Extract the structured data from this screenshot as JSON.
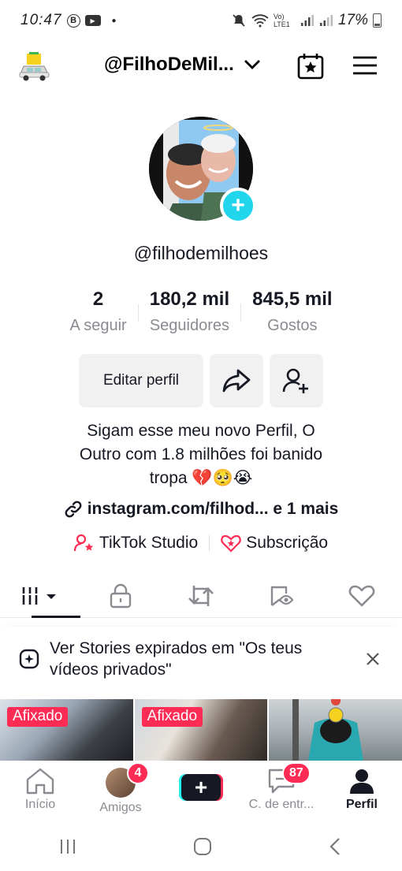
{
  "status_bar": {
    "time": "10:47",
    "b_icon": "B",
    "network": "Vo) LTE1",
    "battery_pct": "17%"
  },
  "header": {
    "handle": "@FilhoDeMil...",
    "icons": [
      "car-logo-icon",
      "chevron-down-icon",
      "calendar-star-icon",
      "menu-icon"
    ]
  },
  "profile": {
    "username": "@filhodemilhoes",
    "stats": [
      {
        "value": "2",
        "label": "A seguir"
      },
      {
        "value": "180,2 mil",
        "label": "Seguidores"
      },
      {
        "value": "845,5 mil",
        "label": "Gostos"
      }
    ],
    "edit_label": "Editar perfil",
    "bio_line1": "Sigam esse meu novo Perfil, O",
    "bio_line2": "Outro com 1.8 milhões foi banido",
    "bio_line3": "tropa 💔🥺😭",
    "link": "instagram.com/filhod... e 1 mais",
    "studio": "TikTok Studio",
    "subscription": "Subscrição"
  },
  "tabs": [
    "videos-grid-icon",
    "lock-icon",
    "repost-icon",
    "saved-icon",
    "heart-icon"
  ],
  "stories_banner": {
    "text": "Ver Stories expirados em \"Os teus vídeos privados\""
  },
  "videos": [
    {
      "badge": "Afixado"
    },
    {
      "badge": "Afixado"
    },
    {
      "badge": ""
    }
  ],
  "bottom_nav": {
    "home": "Início",
    "friends": "Amigos",
    "friends_badge": "4",
    "inbox": "C. de entr...",
    "inbox_badge": "87",
    "profile": "Perfil"
  },
  "colors": {
    "accent_red": "#fe2c55",
    "accent_cyan": "#20d5ec",
    "text": "#161823",
    "muted": "#8a8b91"
  }
}
